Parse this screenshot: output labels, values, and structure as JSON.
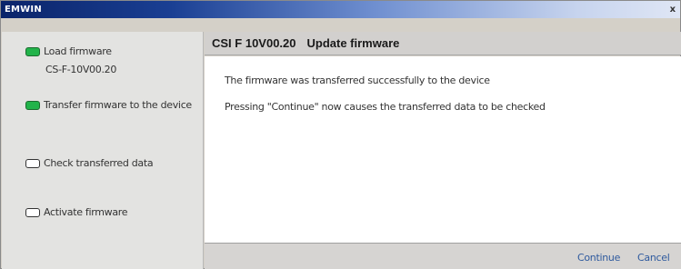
{
  "window": {
    "title": "EMWIN",
    "close_glyph": "x"
  },
  "sidebar": {
    "steps": [
      {
        "label": "Load firmware",
        "sub": "CS-F-10V00.20",
        "state": "done"
      },
      {
        "label": "Transfer firmware to the device",
        "state": "done"
      },
      {
        "label": "Check transferred data",
        "state": "pending"
      },
      {
        "label": "Activate firmware",
        "state": "pending"
      }
    ]
  },
  "main": {
    "device": "CSI F 10V00.20",
    "heading": "Update firmware",
    "messages": [
      "The firmware was transferred successfully to the device",
      "Pressing \"Continue\" now causes the transferred data to be checked"
    ]
  },
  "footer": {
    "continue_label": "Continue",
    "cancel_label": "Cancel"
  },
  "colors": {
    "title_gradient_start": "#0a246a",
    "step_done": "#22b34a",
    "link": "#2f5a9e"
  }
}
